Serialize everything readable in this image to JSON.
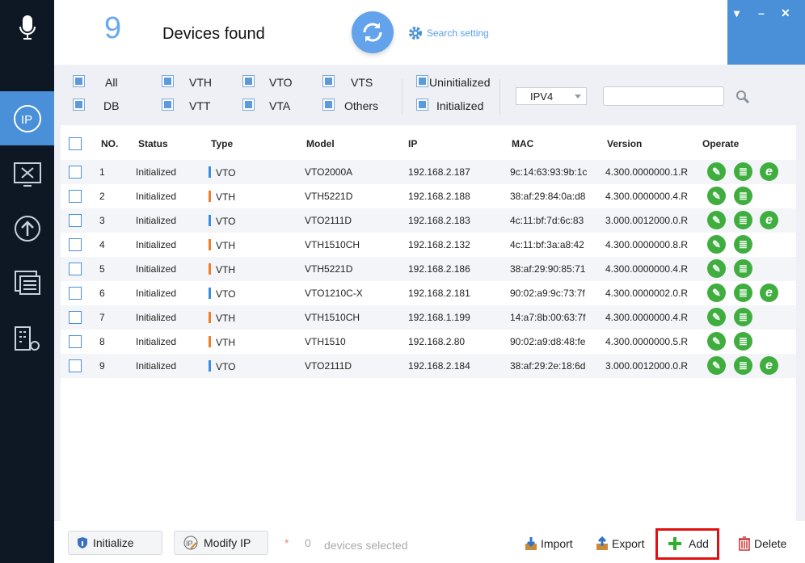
{
  "header": {
    "count": "9",
    "title": "Devices found",
    "search_setting": "Search setting"
  },
  "window": {
    "menu": "▾",
    "minimize": "–",
    "close": "✕"
  },
  "filters": {
    "all": "All",
    "db": "DB",
    "vth": "VTH",
    "vtt": "VTT",
    "vto": "VTO",
    "vta": "VTA",
    "vts": "VTS",
    "others": "Others",
    "uninitialized": "Uninitialized",
    "initialized": "Initialized",
    "ip_version": "IPV4",
    "search_value": ""
  },
  "table": {
    "headers": {
      "no": "NO.",
      "status": "Status",
      "type": "Type",
      "model": "Model",
      "ip": "IP",
      "mac": "MAC",
      "version": "Version",
      "operate": "Operate"
    },
    "rows": [
      {
        "no": "1",
        "status": "Initialized",
        "type": "VTO",
        "model": "VTO2000A",
        "ip": "192.168.2.187",
        "mac": "9c:14:63:93:9b:1c",
        "version": "4.300.0000000.1.R",
        "web": true
      },
      {
        "no": "2",
        "status": "Initialized",
        "type": "VTH",
        "model": "VTH5221D",
        "ip": "192.168.2.188",
        "mac": "38:af:29:84:0a:d8",
        "version": "4.300.0000000.4.R",
        "web": false
      },
      {
        "no": "3",
        "status": "Initialized",
        "type": "VTO",
        "model": "VTO2111D",
        "ip": "192.168.2.183",
        "mac": "4c:11:bf:7d:6c:83",
        "version": "3.000.0012000.0.R",
        "web": true
      },
      {
        "no": "4",
        "status": "Initialized",
        "type": "VTH",
        "model": "VTH1510CH",
        "ip": "192.168.2.132",
        "mac": "4c:11:bf:3a:a8:42",
        "version": "4.300.0000000.8.R",
        "web": false
      },
      {
        "no": "5",
        "status": "Initialized",
        "type": "VTH",
        "model": "VTH5221D",
        "ip": "192.168.2.186",
        "mac": "38:af:29:90:85:71",
        "version": "4.300.0000000.4.R",
        "web": false
      },
      {
        "no": "6",
        "status": "Initialized",
        "type": "VTO",
        "model": "VTO1210C-X",
        "ip": "192.168.2.181",
        "mac": "90:02:a9:9c:73:7f",
        "version": "4.300.0000002.0.R",
        "web": true
      },
      {
        "no": "7",
        "status": "Initialized",
        "type": "VTH",
        "model": "VTH1510CH",
        "ip": "192.168.1.199",
        "mac": "14:a7:8b:00:63:7f",
        "version": "4.300.0000000.4.R",
        "web": false
      },
      {
        "no": "8",
        "status": "Initialized",
        "type": "VTH",
        "model": "VTH1510",
        "ip": "192.168.2.80",
        "mac": "90:02:a9:d8:48:fe",
        "version": "4.300.0000000.5.R",
        "web": false
      },
      {
        "no": "9",
        "status": "Initialized",
        "type": "VTO",
        "model": "VTO2111D",
        "ip": "192.168.2.184",
        "mac": "38:af:29:2e:18:6d",
        "version": "3.000.0012000.0.R",
        "web": true
      }
    ]
  },
  "colors": {
    "VTO": "#3b8de0",
    "VTH": "#f07d2a",
    "accent": "#4a90d9",
    "op_green": "#3fae3f"
  },
  "bottom": {
    "initialize": "Initialize",
    "modify_ip": "Modify IP",
    "asterisk": "*",
    "selected_count": "0",
    "selected_label": "devices selected",
    "import": "Import",
    "export": "Export",
    "add": "Add",
    "delete": "Delete"
  }
}
